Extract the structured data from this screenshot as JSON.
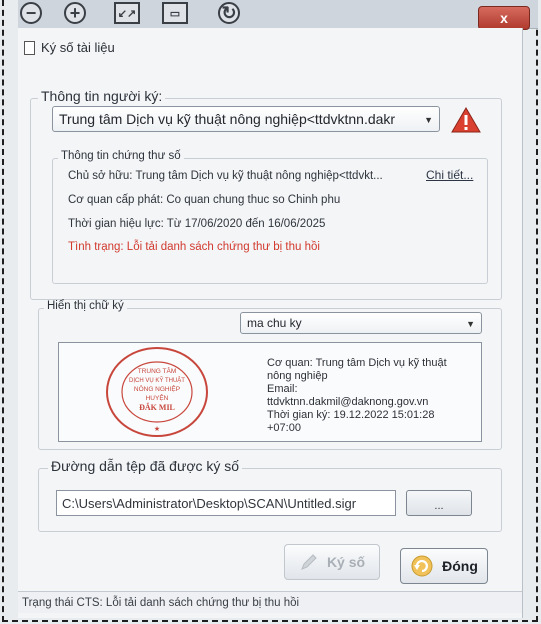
{
  "window": {
    "title": "Ký số tài liệu",
    "close_label": "x"
  },
  "signer_group": {
    "label": "Thông tin người ký:",
    "selected_signer": "Trung tâm Dịch vụ kỹ thuật nông nghiệp<ttdvktnn.dakr"
  },
  "certificate": {
    "label": "Thông tin chứng thư số",
    "owner": "Chủ sở hữu: Trung tâm Dịch vụ kỹ thuật nông nghiệp<ttdvkt...",
    "details_link": "Chi tiết...",
    "issuer": "Cơ quan cấp phát: Co quan chung thuc so Chinh phu",
    "validity": "Thời gian hiệu lực: Từ 17/06/2020 đến 16/06/2025",
    "status": "Tình trạng: Lỗi tải danh sách chứng thư bị thu hồi"
  },
  "signature_display": {
    "label": "Hiển thị chữ ký",
    "selected_style": "ma chu ky",
    "stamp_text": [
      "TRUNG TÂM",
      "DỊCH VỤ KỸ THUẬT",
      "NÔNG NGHIỆP",
      "HUYỆN",
      "ĐẮK MIL"
    ],
    "org_line1": "Cơ quan: Trung tâm Dịch vụ kỹ thuật",
    "org_line2": "nông nghiệp",
    "email_label": "Email:",
    "email": "ttdvktnn.dakmil@daknong.gov.vn",
    "time_line1": "Thời gian ký: 19.12.2022 15:01:28",
    "time_line2": "+07:00"
  },
  "output_path": {
    "label": "Đường dẫn tệp đã được ký số",
    "value": "C:\\Users\\Administrator\\Desktop\\SCAN\\Untitled.sigr",
    "browse_label": "..."
  },
  "buttons": {
    "sign": "Ký số",
    "close": "Đóng"
  },
  "statusbar": {
    "text": "Trạng thái CTS: Lỗi tải danh sách chứng thư bị thu hồi"
  },
  "colors": {
    "error_red": "#d23a2e",
    "warning_red": "#d9402f"
  }
}
